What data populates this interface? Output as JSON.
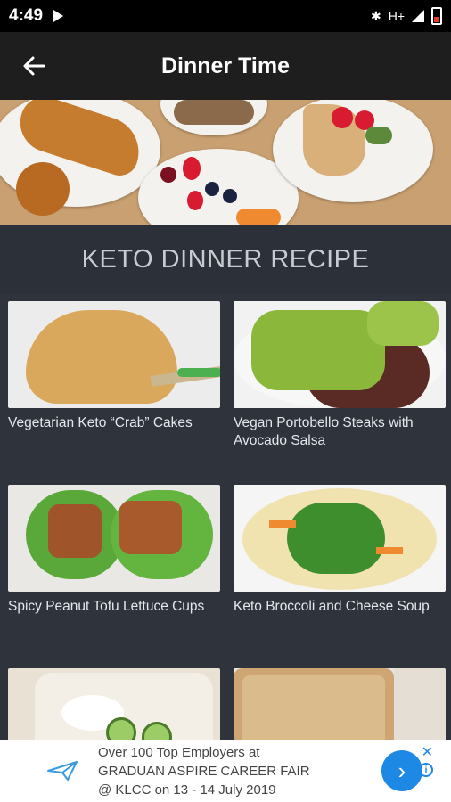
{
  "status": {
    "time": "4:49",
    "network": "H+"
  },
  "appbar": {
    "back_icon": "arrow-left-icon",
    "title": "Dinner Time"
  },
  "section": {
    "title": "KETO DINNER RECIPE"
  },
  "recipes": [
    {
      "name": "Vegetarian Keto “Crab” Cakes"
    },
    {
      "name": "Vegan Portobello Steaks with Avocado Salsa"
    },
    {
      "name": "Spicy Peanut Tofu Lettuce Cups"
    },
    {
      "name": "Keto Broccoli and Cheese Soup"
    },
    {
      "name": ""
    },
    {
      "name": ""
    }
  ],
  "ad": {
    "line1": "Over 100 Top Employers at",
    "line2": "GRADUAN ASPIRE CAREER FAIR",
    "line3": "@ KLCC on 13 - 14 July 2019",
    "close": "✕",
    "info": "i"
  },
  "colors": {
    "background": "#2e333c",
    "appbar": "#1e1e1e",
    "accent": "#1e88e5"
  }
}
